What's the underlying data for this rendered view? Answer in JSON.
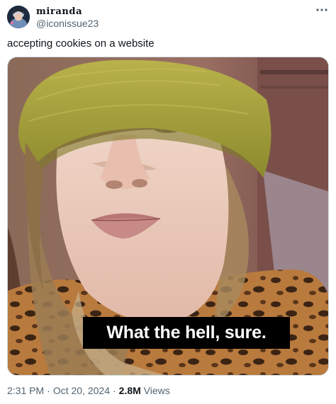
{
  "author": {
    "display_name": "miranda",
    "handle": "@iconissue23"
  },
  "tweet": {
    "text": "accepting cookies on a website"
  },
  "media": {
    "caption": "What the hell, sure."
  },
  "meta": {
    "time": "2:31 PM",
    "date": "Oct 20, 2024",
    "separator": "·",
    "views_count": "2.8M",
    "views_label": "Views"
  },
  "icons": {
    "more": "more-horizontal-icon"
  },
  "colors": {
    "text_primary": "#0f1419",
    "text_secondary": "#536471",
    "caption_bg": "#000000",
    "caption_text": "#ffffff",
    "beanie": "#a5a43a"
  }
}
